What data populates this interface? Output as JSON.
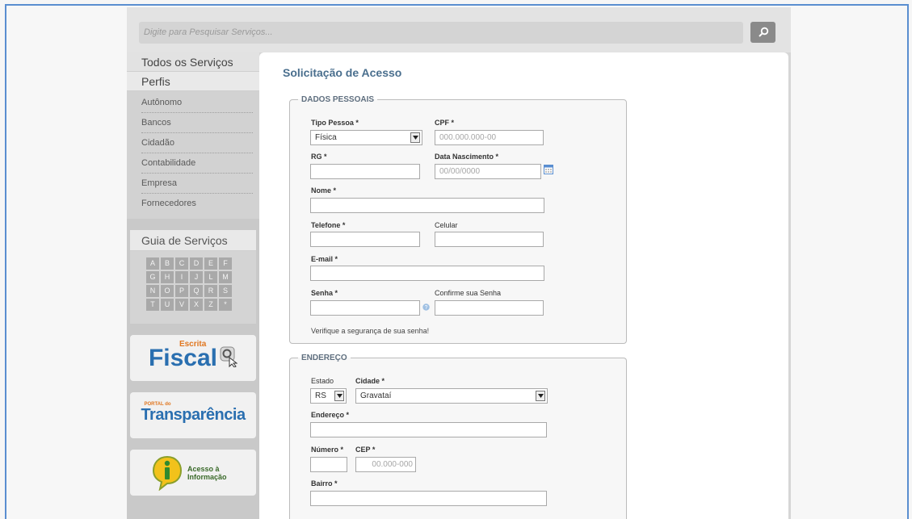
{
  "search": {
    "placeholder": "Digite para Pesquisar Serviços..."
  },
  "sidebar": {
    "all_services": "Todos os Serviços",
    "profiles_title": "Perfis",
    "profiles": [
      "Autônomo",
      "Bancos",
      "Cidadão",
      "Contabilidade",
      "Empresa",
      "Fornecedores"
    ],
    "guide_title": "Guia de Serviços",
    "letters": [
      [
        "A",
        "B",
        "C",
        "D",
        "E",
        "F"
      ],
      [
        "G",
        "H",
        "I",
        "J",
        "L",
        "M"
      ],
      [
        "N",
        "O",
        "P",
        "Q",
        "R",
        "S"
      ],
      [
        "T",
        "U",
        "V",
        "X",
        "Z",
        "*"
      ]
    ],
    "promo1": {
      "small": "Escrita",
      "big": "Fiscal"
    },
    "promo2": {
      "small": "PORTAL do",
      "big": "Transparência"
    },
    "promo3": {
      "line1": "Acesso à",
      "line2": "Informação"
    }
  },
  "main": {
    "title": "Solicitação de Acesso",
    "personal": {
      "legend": "DADOS PESSOAIS",
      "tipo_label": "Tipo Pessoa *",
      "tipo_value": "Física",
      "cpf_label": "CPF *",
      "cpf_placeholder": "000.000.000-00",
      "rg_label": "RG *",
      "birth_label": "Data Nascimento *",
      "birth_placeholder": "00/00/0000",
      "name_label": "Nome *",
      "phone_label": "Telefone *",
      "mobile_label": "Celular",
      "email_label": "E-mail *",
      "password_label": "Senha *",
      "confirm_label": "Confirme sua Senha",
      "password_note": "Verifique a segurança de sua senha!"
    },
    "address": {
      "legend": "ENDEREÇO",
      "state_label": "Estado",
      "state_value": "RS",
      "city_label": "Cidade *",
      "city_value": "Gravataí",
      "street_label": "Endereço *",
      "number_label": "Número *",
      "cep_label": "CEP *",
      "cep_placeholder": "00.000-000",
      "district_label": "Bairro *"
    }
  }
}
